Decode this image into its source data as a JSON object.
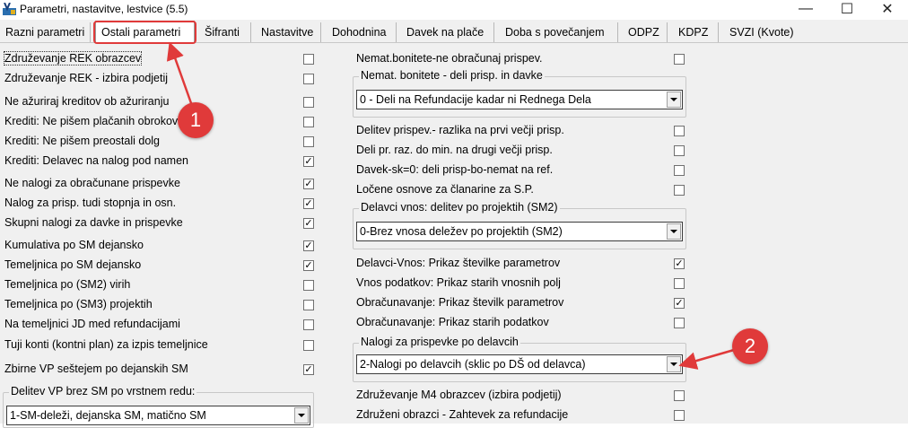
{
  "window": {
    "title": "Parametri, nastavitve, lestvice  (5.5)",
    "minimize_glyph": "—",
    "maximize_glyph": "☐",
    "close_glyph": "✕"
  },
  "tabs": [
    {
      "label": "Razni parametri"
    },
    {
      "label": "Ostali parametri"
    },
    {
      "label": "Šifranti"
    },
    {
      "label": "Nastavitve"
    },
    {
      "label": "Dohodnina"
    },
    {
      "label": "Davek na plače"
    },
    {
      "label": "Doba s povečanjem"
    },
    {
      "label": "ODPZ"
    },
    {
      "label": "KDPZ"
    },
    {
      "label": "SVZI (Kvote)"
    }
  ],
  "left": {
    "items": [
      {
        "label": "Združevanje REK obrazcev",
        "checked": ""
      },
      {
        "label": "Združevanje REK - izbira podjetij",
        "checked": ""
      },
      {
        "label": "Ne ažuriraj kreditov ob ažuriranju",
        "checked": ""
      },
      {
        "label": "Krediti: Ne pišem plačanih obrokov",
        "checked": ""
      },
      {
        "label": "Krediti: Ne pišem preostali dolg",
        "checked": ""
      },
      {
        "label": "Krediti: Delavec na nalog pod namen",
        "checked": "✓"
      },
      {
        "label": "Ne nalogi za obračunane prispevke",
        "checked": "✓"
      },
      {
        "label": "Nalog za prisp. tudi stopnja in osn.",
        "checked": "✓"
      },
      {
        "label": "Skupni nalogi za davke in prispevke",
        "checked": "✓"
      },
      {
        "label": "Kumulativa po SM dejansko",
        "checked": "✓"
      },
      {
        "label": "Temeljnica po SM dejansko",
        "checked": "✓"
      },
      {
        "label": "Temeljnica po (SM2) virih",
        "checked": ""
      },
      {
        "label": "Temeljnica po (SM3) projektih",
        "checked": ""
      },
      {
        "label": "Na temeljnici JD med refundacijami",
        "checked": ""
      },
      {
        "label": "Tuji konti (kontni plan) za izpis temeljnice",
        "checked": ""
      },
      {
        "label": "Zbirne VP seštejem po dejanskih SM",
        "checked": "✓"
      }
    ],
    "group_delitev": {
      "label": "Delitev VP brez SM po vrstnem redu:",
      "value": "1-SM-deleži, dejanska SM, matično SM"
    }
  },
  "right": {
    "items_top": [
      {
        "label": "Nemat.bonitete-ne obračunaj prispev.",
        "checked": ""
      }
    ],
    "group_bonitete": {
      "label": "Nemat. bonitete - deli prisp. in davke",
      "value": "0 - Deli na Refundacije kadar ni Rednega Dela"
    },
    "items_mid": [
      {
        "label": "Delitev prispev.- razlika na prvi večji prisp.",
        "checked": ""
      },
      {
        "label": "Deli pr. raz. do min. na drugi večji prisp.",
        "checked": ""
      },
      {
        "label": "Davek-sk=0: deli prisp-bo-nemat na ref.",
        "checked": ""
      },
      {
        "label": "Ločene osnove za članarine za S.P.",
        "checked": ""
      }
    ],
    "group_delavci": {
      "label": "Delavci vnos: delitev po projektih (SM2)",
      "value": "0-Brez vnosa deležev po projektih (SM2)"
    },
    "items_low": [
      {
        "label": "Delavci-Vnos: Prikaz številke parametrov",
        "checked": "✓"
      },
      {
        "label": "Vnos podatkov: Prikaz starih vnosnih polj",
        "checked": ""
      },
      {
        "label": "Obračunavanje: Prikaz številk parametrov",
        "checked": "✓"
      },
      {
        "label": "Obračunavanje: Prikaz starih podatkov",
        "checked": ""
      }
    ],
    "group_nalogi": {
      "label": "Nalogi za prispevke po delavcih",
      "value": "2-Nalogi po delavcih (sklic po DŠ od delavca)"
    },
    "items_bottom": [
      {
        "label": "Združevanje M4 obrazcev (izbira podjetij)",
        "checked": ""
      },
      {
        "label": "Združeni obrazci - Zahtevek za refundacije",
        "checked": ""
      }
    ]
  },
  "annotations": {
    "badge_1": "1",
    "badge_2": "2",
    "color": "#e03a3a"
  }
}
